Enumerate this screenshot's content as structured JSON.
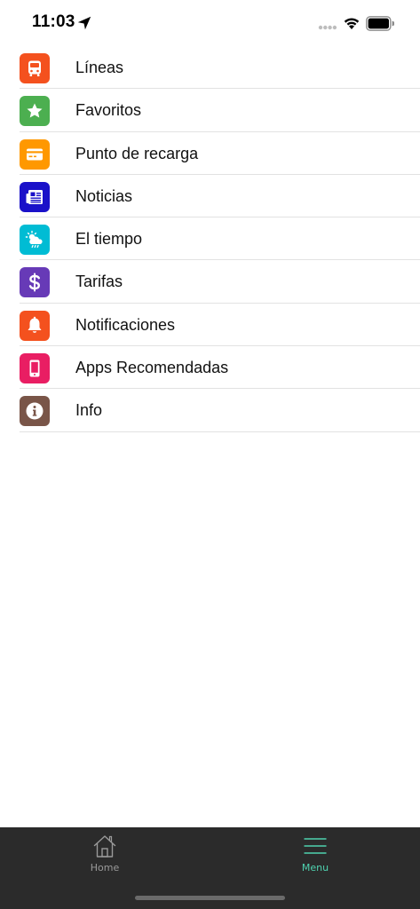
{
  "status_bar": {
    "time": "11:03"
  },
  "menu": {
    "items": [
      {
        "label": "Líneas",
        "icon": "bus-icon",
        "color": "#f4511e"
      },
      {
        "label": "Favoritos",
        "icon": "star-icon",
        "color": "#4caf50"
      },
      {
        "label": "Punto de recarga",
        "icon": "card-icon",
        "color": "#ff9800"
      },
      {
        "label": "Noticias",
        "icon": "newspaper-icon",
        "color": "#1a11c9"
      },
      {
        "label": "El tiempo",
        "icon": "weather-icon",
        "color": "#00bcd4"
      },
      {
        "label": "Tarifas",
        "icon": "dollar-icon",
        "color": "#673ab7"
      },
      {
        "label": "Notificaciones",
        "icon": "bell-icon",
        "color": "#f4511e"
      },
      {
        "label": "Apps Recomendadas",
        "icon": "phone-icon",
        "color": "#e91e63"
      },
      {
        "label": "Info",
        "icon": "info-icon",
        "color": "#795548"
      }
    ]
  },
  "tab_bar": {
    "home_label": "Home",
    "menu_label": "Menu",
    "active_color": "#4fd3b0",
    "inactive_color": "#9a9a9a"
  }
}
